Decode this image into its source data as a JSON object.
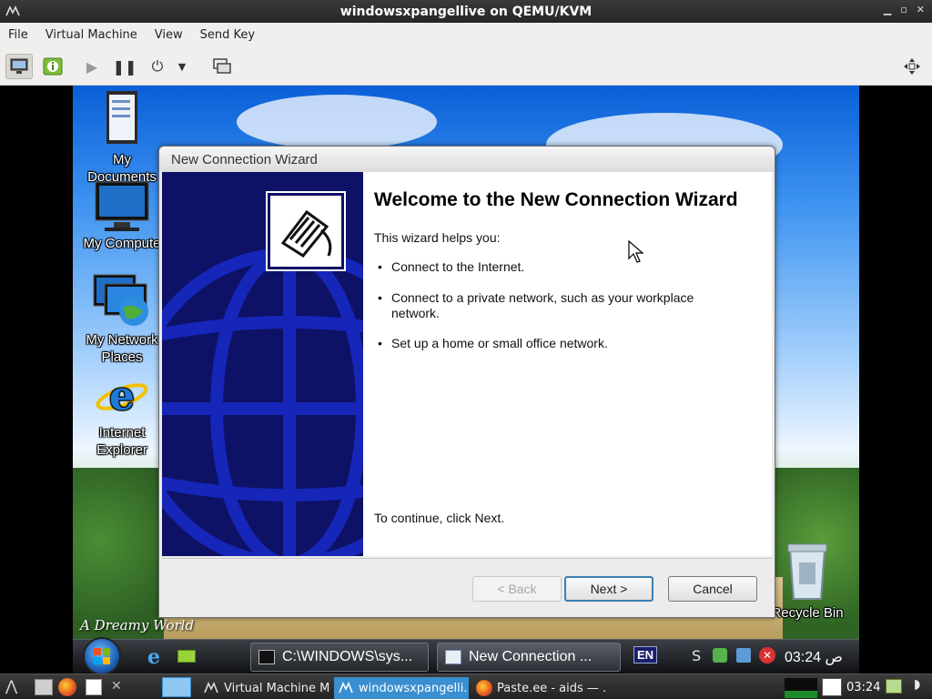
{
  "host": {
    "title": "windowsxpangellive on QEMU/KVM",
    "menu": [
      "File",
      "Virtual Machine",
      "View",
      "Send Key"
    ],
    "toolbar": {
      "console_icon": "monitor-icon",
      "details_icon": "info-icon",
      "run_icon": "play-icon",
      "pause_icon": "pause-icon",
      "shutdown_icon": "power-icon",
      "shutdown_menu_icon": "chevron-down-icon",
      "snapshots_icon": "snapshots-icon",
      "fullscreen_icon": "resize-icon"
    }
  },
  "desktop": {
    "icons": [
      {
        "label": "My Documents",
        "icon": "documents-icon"
      },
      {
        "label": "My Compute",
        "icon": "computer-icon"
      },
      {
        "label": "My Network Places",
        "icon": "network-places-icon"
      },
      {
        "label": "Internet Explorer",
        "icon": "internet-explorer-icon"
      }
    ],
    "recycle_bin": "Recycle Bin",
    "watermark": "A Dreamy World"
  },
  "wizard": {
    "title": "New Connection Wizard",
    "heading": "Welcome to the New Connection Wizard",
    "intro": "This wizard helps you:",
    "bullets": [
      "Connect to the Internet.",
      "Connect to a private network, such as your workplace network.",
      "Set up a home or small office network."
    ],
    "continue_text": "To continue, click Next.",
    "buttons": {
      "back": "< Back",
      "next": "Next >",
      "cancel": "Cancel"
    },
    "back_disabled": true
  },
  "guest_taskbar": {
    "tasks": [
      {
        "label": "C:\\WINDOWS\\sys...",
        "icon": "cmd-icon"
      },
      {
        "label": "New Connection ...",
        "icon": "wizard-icon"
      }
    ],
    "language": "EN",
    "clock": "03:24 ص"
  },
  "host_panel": {
    "tasks": [
      {
        "label": "Virtual Machine M...",
        "active": false
      },
      {
        "label": "windowsxpangelli...",
        "active": true
      },
      {
        "label": "Paste.ee - aids — ...",
        "active": false
      }
    ],
    "clock": "03:24"
  },
  "colors": {
    "wizard_side": "#0d1266",
    "host_active_task": "#3a8fd0"
  }
}
